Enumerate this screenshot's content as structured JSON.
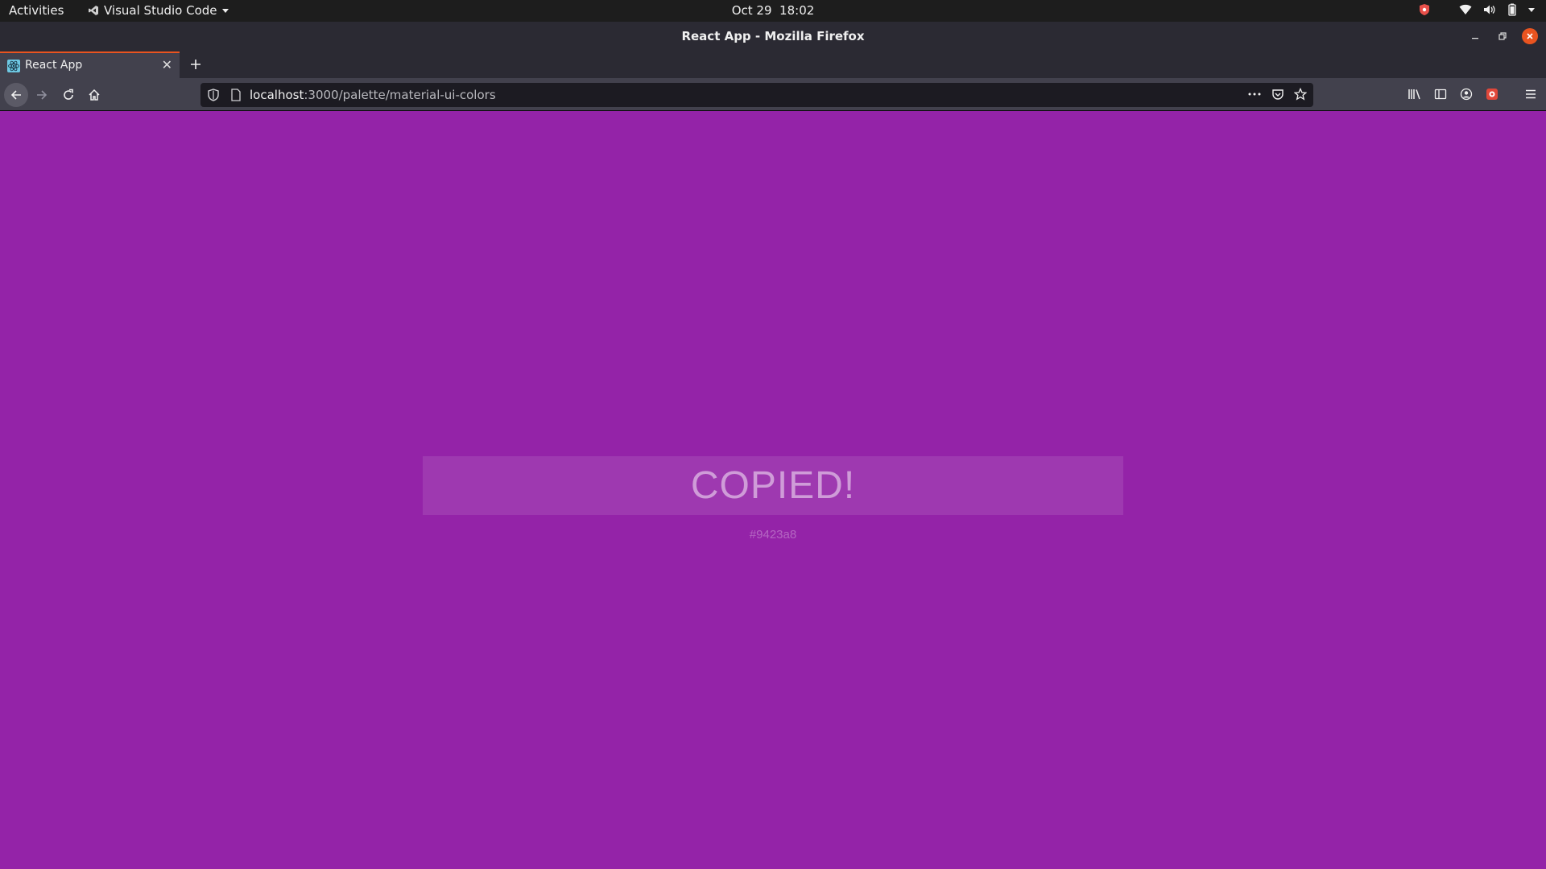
{
  "system_bar": {
    "activities_label": "Activities",
    "app_name": "Visual Studio Code",
    "date": "Oct 29",
    "time": "18:02"
  },
  "window": {
    "title": "React App - Mozilla Firefox"
  },
  "tabs": [
    {
      "label": "React App",
      "active": true
    }
  ],
  "urlbar": {
    "host": "localhost",
    "path": ":3000/palette/material-ui-colors"
  },
  "page": {
    "background_color": "#9423a8",
    "copied_message": "COPIED!",
    "copied_color": "#9423a8"
  }
}
